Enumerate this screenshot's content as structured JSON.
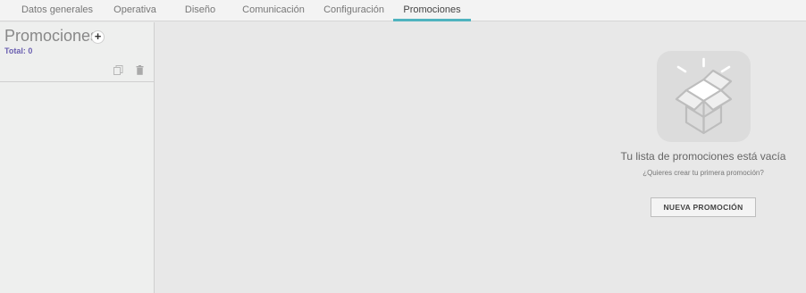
{
  "tabs": [
    {
      "label": "Datos generales"
    },
    {
      "label": "Operativa"
    },
    {
      "label": "Diseño"
    },
    {
      "label": "Comunicación"
    },
    {
      "label": "Configuración"
    },
    {
      "label": "Promociones",
      "active": true
    }
  ],
  "sidebar": {
    "title": "Promociones",
    "add_symbol": "+",
    "total": "Total: 0",
    "icons": [
      "copy-icon",
      "trash-icon"
    ]
  },
  "empty_state": {
    "icon": "open-box-icon",
    "title": "Tu lista de promociones está vacía",
    "subtitle": "¿Quieres crear tu primera promoción?",
    "button_label": "NUEVA PROMOCIÓN"
  },
  "colors": {
    "accent": "#4fb3bf",
    "total_text": "#6a5fb0"
  }
}
